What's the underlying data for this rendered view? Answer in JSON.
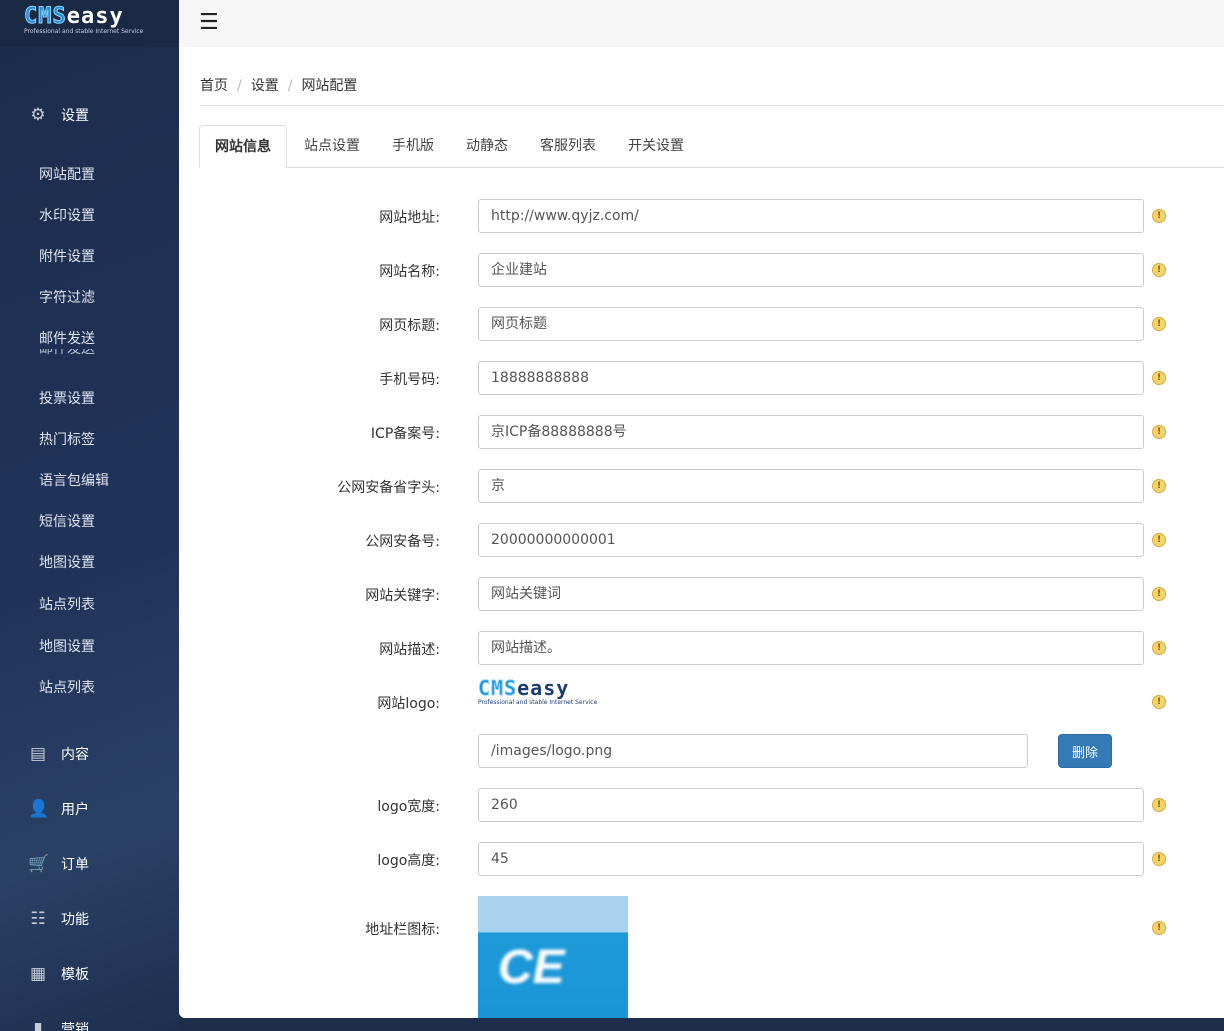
{
  "logo": {
    "brand_cms": "CMS",
    "brand_easy": "easy",
    "tagline": "Professional and stable Internet Service"
  },
  "sidebar": {
    "settings_label": "设置",
    "sub_items": [
      "网站配置",
      "水印设置",
      "附件设置",
      "字符过滤",
      "邮件发送",
      "投票设置",
      "热门标签",
      "语言包编辑",
      "短信设置",
      "地图设置",
      "站点列表",
      "地图设置",
      "站点列表"
    ],
    "ghost_item": "邮件发送",
    "groups": [
      {
        "label": "内容",
        "icon": "list-icon"
      },
      {
        "label": "用户",
        "icon": "user-icon"
      },
      {
        "label": "订单",
        "icon": "cart-icon"
      },
      {
        "label": "功能",
        "icon": "table-icon"
      },
      {
        "label": "模板",
        "icon": "grid-icon"
      },
      {
        "label": "营销",
        "icon": "chart-icon"
      }
    ]
  },
  "breadcrumb": [
    "首页",
    "设置",
    "网站配置"
  ],
  "tabs": [
    "网站信息",
    "站点设置",
    "手机版",
    "动静态",
    "客服列表",
    "开关设置"
  ],
  "form": {
    "fields": [
      {
        "label": "网站地址:",
        "value": "http://www.qyjz.com/"
      },
      {
        "label": "网站名称:",
        "value": "企业建站"
      },
      {
        "label": "网页标题:",
        "value": "网页标题"
      },
      {
        "label": "手机号码:",
        "value": "18888888888"
      },
      {
        "label": "ICP备案号:",
        "value": "京ICP备88888888号"
      },
      {
        "label": "公网安备省字头:",
        "value": "京"
      },
      {
        "label": "公网安备号:",
        "value": "20000000000001"
      },
      {
        "label": "网站关键字:",
        "value": "网站关键词"
      },
      {
        "label": "网站描述:",
        "value": "网站描述。"
      }
    ],
    "logo_label": "网站logo:",
    "logo_path": "/images/logo.png",
    "delete_label": "删除",
    "logo_width_label": "logo宽度:",
    "logo_width": "260",
    "logo_height_label": "logo高度:",
    "logo_height": "45",
    "favicon_label": "地址栏图标:",
    "favicon_text": "CE",
    "info_glyph": "!"
  }
}
